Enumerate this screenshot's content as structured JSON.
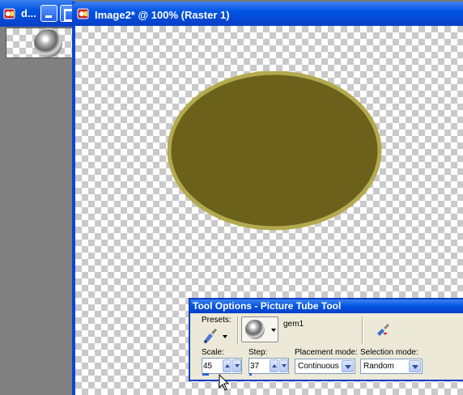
{
  "left_window": {
    "title": "d...",
    "tube_thumbnail": "gem-thumbnail"
  },
  "image_window": {
    "title": "Image2* @ 100% (Raster 1)",
    "shape": {
      "type": "ellipse",
      "fill": "#6b611b",
      "stroke": "#b3a94e"
    }
  },
  "tool_options": {
    "title": "Tool Options - Picture Tube Tool",
    "presets_label": "Presets:",
    "tube_name": "gem1",
    "scale": {
      "label": "Scale:",
      "value": "45"
    },
    "step": {
      "label": "Step:",
      "value": "37"
    },
    "placement_mode": {
      "label": "Placement mode:",
      "value": "Continuous"
    },
    "selection_mode": {
      "label": "Selection mode:",
      "value": "Random"
    }
  },
  "colors": {
    "titlebar": "#0054e3",
    "window_border": "#0a46d8",
    "workspace": "#7a7a7a",
    "palette_bg": "#ece9d8"
  }
}
